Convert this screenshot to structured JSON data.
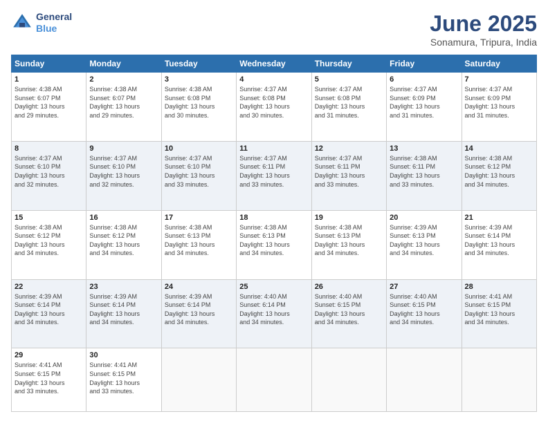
{
  "header": {
    "logo_line1": "General",
    "logo_line2": "Blue",
    "month_title": "June 2025",
    "location": "Sonamura, Tripura, India"
  },
  "days_of_week": [
    "Sunday",
    "Monday",
    "Tuesday",
    "Wednesday",
    "Thursday",
    "Friday",
    "Saturday"
  ],
  "weeks": [
    [
      {
        "day": "1",
        "info": "Sunrise: 4:38 AM\nSunset: 6:07 PM\nDaylight: 13 hours\nand 29 minutes."
      },
      {
        "day": "2",
        "info": "Sunrise: 4:38 AM\nSunset: 6:07 PM\nDaylight: 13 hours\nand 29 minutes."
      },
      {
        "day": "3",
        "info": "Sunrise: 4:38 AM\nSunset: 6:08 PM\nDaylight: 13 hours\nand 30 minutes."
      },
      {
        "day": "4",
        "info": "Sunrise: 4:37 AM\nSunset: 6:08 PM\nDaylight: 13 hours\nand 30 minutes."
      },
      {
        "day": "5",
        "info": "Sunrise: 4:37 AM\nSunset: 6:08 PM\nDaylight: 13 hours\nand 31 minutes."
      },
      {
        "day": "6",
        "info": "Sunrise: 4:37 AM\nSunset: 6:09 PM\nDaylight: 13 hours\nand 31 minutes."
      },
      {
        "day": "7",
        "info": "Sunrise: 4:37 AM\nSunset: 6:09 PM\nDaylight: 13 hours\nand 31 minutes."
      }
    ],
    [
      {
        "day": "8",
        "info": "Sunrise: 4:37 AM\nSunset: 6:10 PM\nDaylight: 13 hours\nand 32 minutes."
      },
      {
        "day": "9",
        "info": "Sunrise: 4:37 AM\nSunset: 6:10 PM\nDaylight: 13 hours\nand 32 minutes."
      },
      {
        "day": "10",
        "info": "Sunrise: 4:37 AM\nSunset: 6:10 PM\nDaylight: 13 hours\nand 33 minutes."
      },
      {
        "day": "11",
        "info": "Sunrise: 4:37 AM\nSunset: 6:11 PM\nDaylight: 13 hours\nand 33 minutes."
      },
      {
        "day": "12",
        "info": "Sunrise: 4:37 AM\nSunset: 6:11 PM\nDaylight: 13 hours\nand 33 minutes."
      },
      {
        "day": "13",
        "info": "Sunrise: 4:38 AM\nSunset: 6:11 PM\nDaylight: 13 hours\nand 33 minutes."
      },
      {
        "day": "14",
        "info": "Sunrise: 4:38 AM\nSunset: 6:12 PM\nDaylight: 13 hours\nand 34 minutes."
      }
    ],
    [
      {
        "day": "15",
        "info": "Sunrise: 4:38 AM\nSunset: 6:12 PM\nDaylight: 13 hours\nand 34 minutes."
      },
      {
        "day": "16",
        "info": "Sunrise: 4:38 AM\nSunset: 6:12 PM\nDaylight: 13 hours\nand 34 minutes."
      },
      {
        "day": "17",
        "info": "Sunrise: 4:38 AM\nSunset: 6:13 PM\nDaylight: 13 hours\nand 34 minutes."
      },
      {
        "day": "18",
        "info": "Sunrise: 4:38 AM\nSunset: 6:13 PM\nDaylight: 13 hours\nand 34 minutes."
      },
      {
        "day": "19",
        "info": "Sunrise: 4:38 AM\nSunset: 6:13 PM\nDaylight: 13 hours\nand 34 minutes."
      },
      {
        "day": "20",
        "info": "Sunrise: 4:39 AM\nSunset: 6:13 PM\nDaylight: 13 hours\nand 34 minutes."
      },
      {
        "day": "21",
        "info": "Sunrise: 4:39 AM\nSunset: 6:14 PM\nDaylight: 13 hours\nand 34 minutes."
      }
    ],
    [
      {
        "day": "22",
        "info": "Sunrise: 4:39 AM\nSunset: 6:14 PM\nDaylight: 13 hours\nand 34 minutes."
      },
      {
        "day": "23",
        "info": "Sunrise: 4:39 AM\nSunset: 6:14 PM\nDaylight: 13 hours\nand 34 minutes."
      },
      {
        "day": "24",
        "info": "Sunrise: 4:39 AM\nSunset: 6:14 PM\nDaylight: 13 hours\nand 34 minutes."
      },
      {
        "day": "25",
        "info": "Sunrise: 4:40 AM\nSunset: 6:14 PM\nDaylight: 13 hours\nand 34 minutes."
      },
      {
        "day": "26",
        "info": "Sunrise: 4:40 AM\nSunset: 6:15 PM\nDaylight: 13 hours\nand 34 minutes."
      },
      {
        "day": "27",
        "info": "Sunrise: 4:40 AM\nSunset: 6:15 PM\nDaylight: 13 hours\nand 34 minutes."
      },
      {
        "day": "28",
        "info": "Sunrise: 4:41 AM\nSunset: 6:15 PM\nDaylight: 13 hours\nand 34 minutes."
      }
    ],
    [
      {
        "day": "29",
        "info": "Sunrise: 4:41 AM\nSunset: 6:15 PM\nDaylight: 13 hours\nand 33 minutes."
      },
      {
        "day": "30",
        "info": "Sunrise: 4:41 AM\nSunset: 6:15 PM\nDaylight: 13 hours\nand 33 minutes."
      },
      {
        "day": "",
        "info": ""
      },
      {
        "day": "",
        "info": ""
      },
      {
        "day": "",
        "info": ""
      },
      {
        "day": "",
        "info": ""
      },
      {
        "day": "",
        "info": ""
      }
    ]
  ]
}
